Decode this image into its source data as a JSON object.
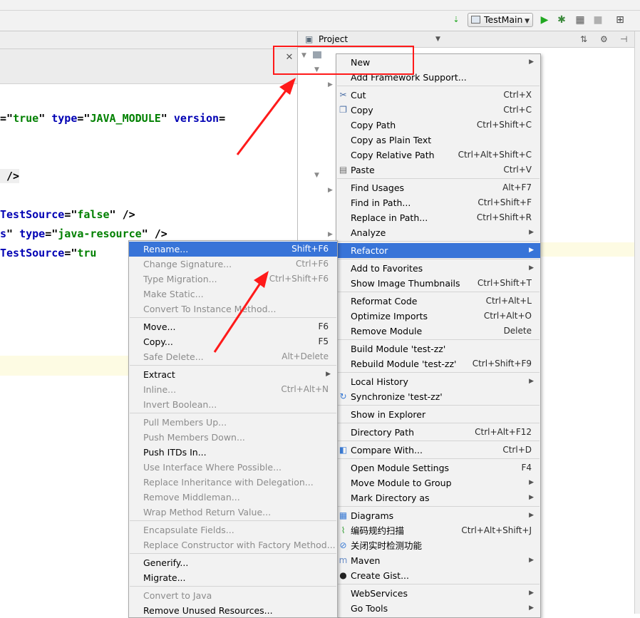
{
  "toolbar": {
    "run_config": "TestMain",
    "colors": {
      "run": "#21a821",
      "debug": "#3c8a3c",
      "stop": "#b0b0b0"
    }
  },
  "project_panel": {
    "title": "Project"
  },
  "editor": {
    "lines": [
      {
        "parts": [
          [
            "p",
            "=\""
          ],
          [
            "s",
            "true"
          ],
          [
            "p",
            "\" "
          ],
          [
            "k",
            "type"
          ],
          [
            "p",
            "=\""
          ],
          [
            "s",
            "JAVA_MODULE"
          ],
          [
            "p",
            "\" "
          ],
          [
            "k",
            "version"
          ],
          [
            "p",
            "="
          ]
        ]
      },
      {
        "parts": [
          [
            "p",
            " />"
          ]
        ]
      },
      {
        "parts": [
          [
            "k",
            "TestSource"
          ],
          [
            "p",
            "=\""
          ],
          [
            "s",
            "false"
          ],
          [
            "p",
            "\" />"
          ]
        ]
      },
      {
        "parts": [
          [
            "k",
            "s"
          ],
          [
            "p",
            "\" "
          ],
          [
            "k",
            "type"
          ],
          [
            "p",
            "=\""
          ],
          [
            "s",
            "java-resource"
          ],
          [
            "p",
            "\" />"
          ]
        ]
      },
      {
        "parts": [
          [
            "k",
            "TestSource"
          ],
          [
            "p",
            "=\""
          ],
          [
            "s",
            "tru"
          ]
        ]
      }
    ]
  },
  "main_menu": {
    "items": [
      {
        "label": "New",
        "shortcut": "",
        "submenu": true,
        "icon": "",
        "disabled": false,
        "selected": false
      },
      {
        "label": "Add Framework Support...",
        "shortcut": "",
        "submenu": false,
        "icon": "",
        "disabled": false,
        "selected": false
      },
      {
        "sep": true
      },
      {
        "label": "Cut",
        "shortcut": "Ctrl+X",
        "icon": "scissors-icon",
        "disabled": false
      },
      {
        "label": "Copy",
        "shortcut": "Ctrl+C",
        "icon": "copy-icon",
        "disabled": false
      },
      {
        "label": "Copy Path",
        "shortcut": "Ctrl+Shift+C",
        "disabled": false
      },
      {
        "label": "Copy as Plain Text",
        "shortcut": "",
        "disabled": false
      },
      {
        "label": "Copy Relative Path",
        "shortcut": "Ctrl+Alt+Shift+C",
        "disabled": false
      },
      {
        "label": "Paste",
        "shortcut": "Ctrl+V",
        "icon": "paste-icon",
        "disabled": false
      },
      {
        "sep": true
      },
      {
        "label": "Find Usages",
        "shortcut": "Alt+F7",
        "disabled": false
      },
      {
        "label": "Find in Path...",
        "shortcut": "Ctrl+Shift+F",
        "disabled": false
      },
      {
        "label": "Replace in Path...",
        "shortcut": "Ctrl+Shift+R",
        "disabled": false
      },
      {
        "label": "Analyze",
        "shortcut": "",
        "submenu": true,
        "disabled": false
      },
      {
        "sep": true
      },
      {
        "label": "Refactor",
        "shortcut": "",
        "submenu": true,
        "selected": true
      },
      {
        "sep": true
      },
      {
        "label": "Add to Favorites",
        "shortcut": "",
        "submenu": true
      },
      {
        "label": "Show Image Thumbnails",
        "shortcut": "Ctrl+Shift+T"
      },
      {
        "sep": true
      },
      {
        "label": "Reformat Code",
        "shortcut": "Ctrl+Alt+L"
      },
      {
        "label": "Optimize Imports",
        "shortcut": "Ctrl+Alt+O"
      },
      {
        "label": "Remove Module",
        "shortcut": "Delete"
      },
      {
        "sep": true
      },
      {
        "label": "Build Module 'test-zz'",
        "shortcut": ""
      },
      {
        "label": "Rebuild Module 'test-zz'",
        "shortcut": "Ctrl+Shift+F9"
      },
      {
        "sep": true
      },
      {
        "label": "Local History",
        "shortcut": "",
        "submenu": true
      },
      {
        "label": "Synchronize 'test-zz'",
        "shortcut": "",
        "icon": "sync-icon"
      },
      {
        "sep": true
      },
      {
        "label": "Show in Explorer",
        "shortcut": ""
      },
      {
        "sep": true
      },
      {
        "label": "Directory Path",
        "shortcut": "Ctrl+Alt+F12"
      },
      {
        "sep": true
      },
      {
        "label": "Compare With...",
        "shortcut": "Ctrl+D",
        "icon": "compare-icon"
      },
      {
        "sep": true
      },
      {
        "label": "Open Module Settings",
        "shortcut": "F4"
      },
      {
        "label": "Move Module to Group",
        "shortcut": "",
        "submenu": true
      },
      {
        "label": "Mark Directory as",
        "shortcut": "",
        "submenu": true
      },
      {
        "sep": true
      },
      {
        "label": "Diagrams",
        "shortcut": "",
        "submenu": true,
        "icon": "diagram-icon"
      },
      {
        "label": "编码规约扫描",
        "shortcut": "Ctrl+Alt+Shift+J",
        "icon": "scan-icon"
      },
      {
        "label": "关闭实时检测功能",
        "shortcut": "",
        "icon": "disable-icon"
      },
      {
        "label": "Maven",
        "shortcut": "",
        "submenu": true,
        "icon": "maven-icon"
      },
      {
        "label": "Create Gist...",
        "shortcut": "",
        "icon": "github-icon"
      },
      {
        "sep": true
      },
      {
        "label": "WebServices",
        "shortcut": "",
        "submenu": true
      },
      {
        "label": "Go Tools",
        "shortcut": "",
        "submenu": true
      }
    ]
  },
  "refactor_menu": {
    "items": [
      {
        "label": "Rename...",
        "shortcut": "Shift+F6",
        "selected": true
      },
      {
        "label": "Change Signature...",
        "shortcut": "Ctrl+F6",
        "disabled": true
      },
      {
        "label": "Type Migration...",
        "shortcut": "Ctrl+Shift+F6",
        "disabled": true
      },
      {
        "label": "Make Static...",
        "shortcut": "",
        "disabled": true
      },
      {
        "label": "Convert To Instance Method...",
        "shortcut": "",
        "disabled": true
      },
      {
        "sep": true
      },
      {
        "label": "Move...",
        "shortcut": "F6"
      },
      {
        "label": "Copy...",
        "shortcut": "F5"
      },
      {
        "label": "Safe Delete...",
        "shortcut": "Alt+Delete",
        "disabled": true
      },
      {
        "sep": true
      },
      {
        "label": "Extract",
        "shortcut": "",
        "submenu": true
      },
      {
        "label": "Inline...",
        "shortcut": "Ctrl+Alt+N",
        "disabled": true
      },
      {
        "label": "Invert Boolean...",
        "shortcut": "",
        "disabled": true
      },
      {
        "sep": true
      },
      {
        "label": "Pull Members Up...",
        "shortcut": "",
        "disabled": true
      },
      {
        "label": "Push Members Down...",
        "shortcut": "",
        "disabled": true
      },
      {
        "label": "Push ITDs In...",
        "shortcut": ""
      },
      {
        "label": "Use Interface Where Possible...",
        "shortcut": "",
        "disabled": true
      },
      {
        "label": "Replace Inheritance with Delegation...",
        "shortcut": "",
        "disabled": true
      },
      {
        "label": "Remove Middleman...",
        "shortcut": "",
        "disabled": true
      },
      {
        "label": "Wrap Method Return Value...",
        "shortcut": "",
        "disabled": true
      },
      {
        "sep": true
      },
      {
        "label": "Encapsulate Fields...",
        "shortcut": "",
        "disabled": true
      },
      {
        "label": "Replace Constructor with Factory Method...",
        "shortcut": "",
        "disabled": true
      },
      {
        "sep": true
      },
      {
        "label": "Generify...",
        "shortcut": ""
      },
      {
        "label": "Migrate...",
        "shortcut": ""
      },
      {
        "sep": true
      },
      {
        "label": "Convert to Java",
        "shortcut": "",
        "disabled": true
      },
      {
        "label": "Remove Unused Resources...",
        "shortcut": ""
      }
    ]
  },
  "annotation_color": "#ff1a1a"
}
